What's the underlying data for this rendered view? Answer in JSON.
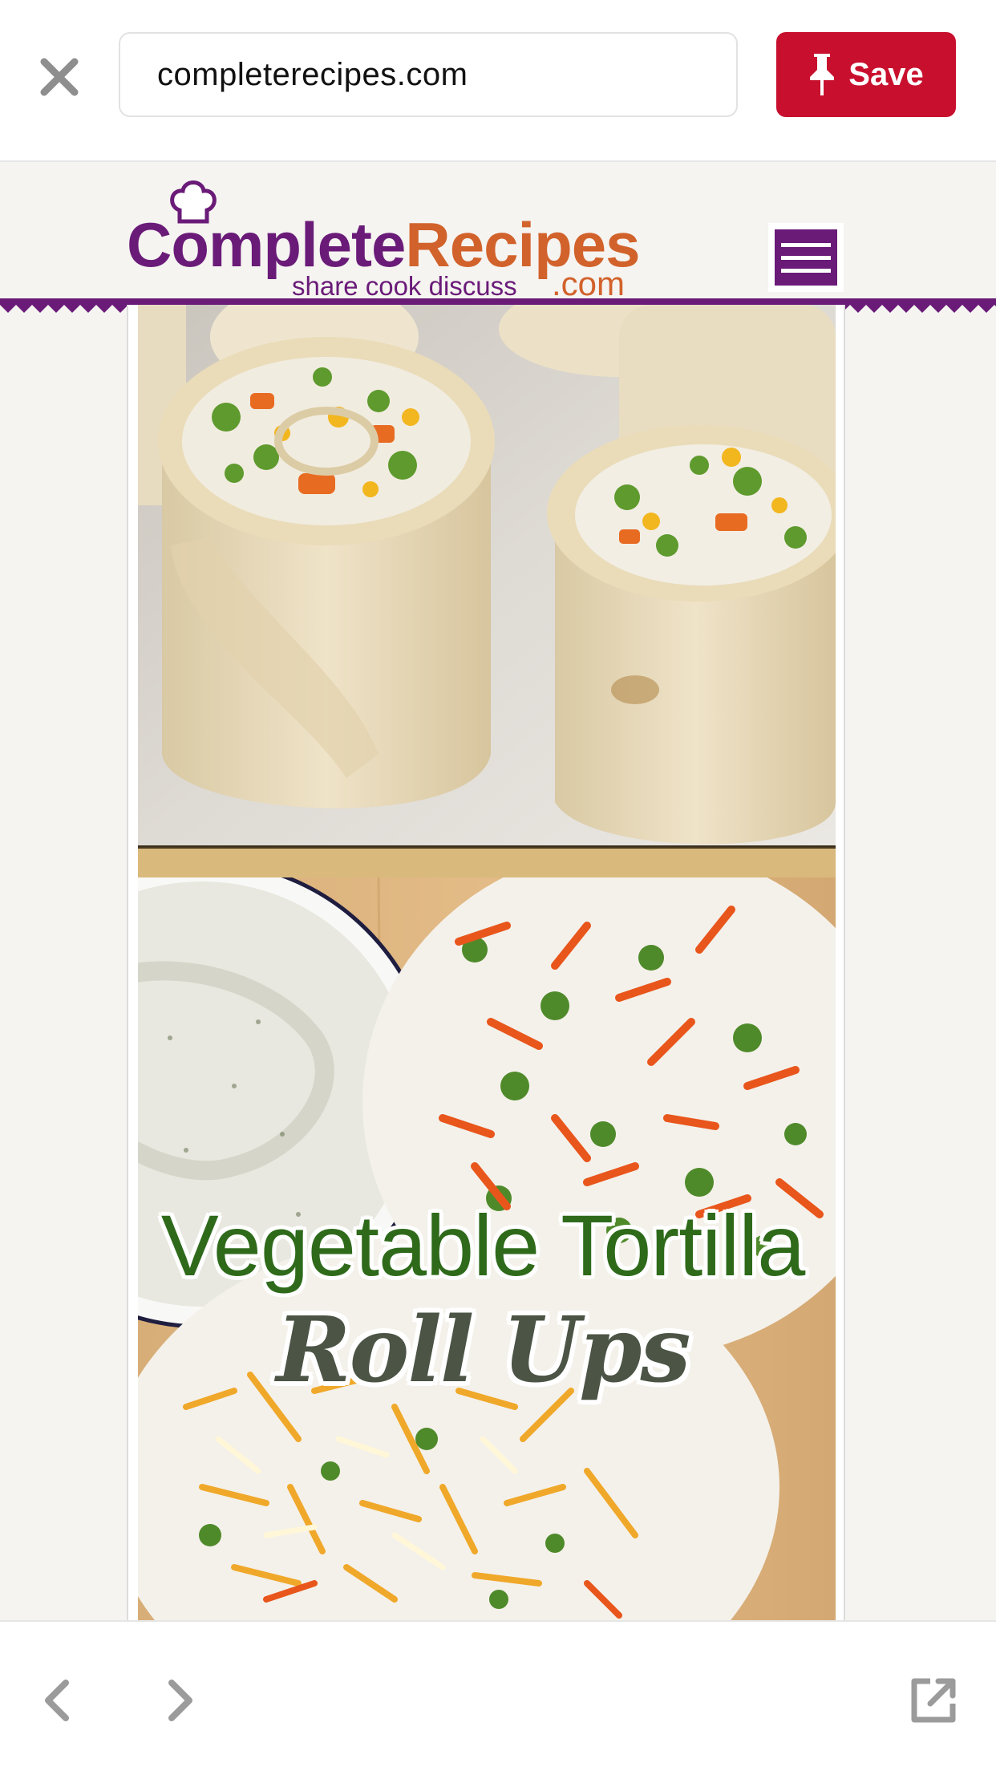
{
  "browser": {
    "url": "completerecipes.com",
    "save_label": "Save",
    "close_icon": "close-icon",
    "pin_icon": "pushpin-icon",
    "save_color": "#c8102e"
  },
  "site": {
    "logo_part1": "Complete",
    "logo_part2": "Recipes",
    "logo_tagline": "share cook discuss",
    "logo_domain": ".com",
    "brand_purple": "#6a1b78",
    "brand_orange": "#d2622b",
    "menu_icon": "hamburger-menu-icon"
  },
  "content": {
    "title_line1": "Vegetable Tortilla",
    "title_line2": "Roll Ups"
  },
  "toolbar": {
    "back_icon": "chevron-left-icon",
    "forward_icon": "chevron-right-icon",
    "external_icon": "open-external-icon"
  }
}
